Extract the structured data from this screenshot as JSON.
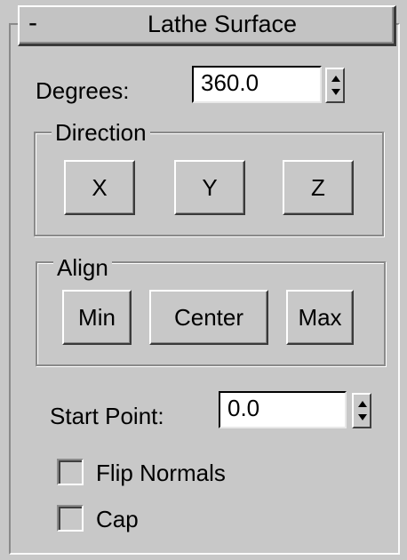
{
  "rollout": {
    "collapse_symbol": "-",
    "title": "Lathe Surface"
  },
  "degrees": {
    "label": "Degrees:",
    "value": "360.0"
  },
  "direction": {
    "label": "Direction",
    "buttons": [
      "X",
      "Y",
      "Z"
    ]
  },
  "align": {
    "label": "Align",
    "buttons": [
      "Min",
      "Center",
      "Max"
    ]
  },
  "start_point": {
    "label": "Start Point:",
    "value": "0.0"
  },
  "options": [
    {
      "label": "Flip Normals",
      "checked": false
    },
    {
      "label": "Cap",
      "checked": false
    }
  ]
}
